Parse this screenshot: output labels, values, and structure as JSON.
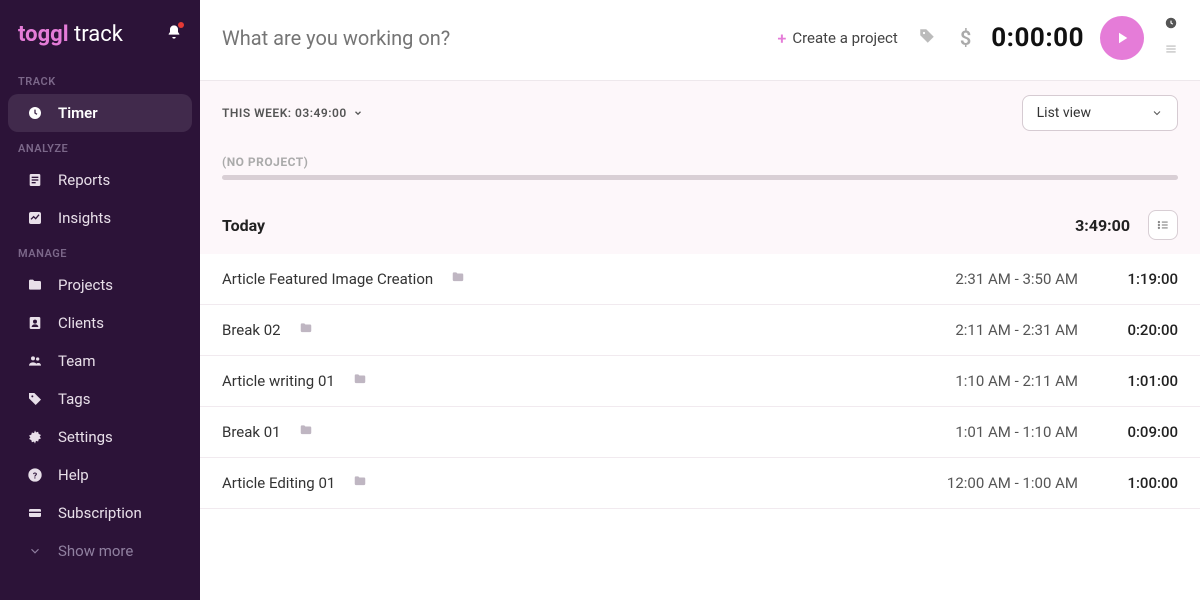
{
  "logo": {
    "part1": "toggl",
    "part2": " track"
  },
  "sidebar": {
    "sections": [
      {
        "label": "TRACK",
        "items": [
          {
            "icon": "clock-icon",
            "label": "Timer",
            "active": true
          }
        ]
      },
      {
        "label": "ANALYZE",
        "items": [
          {
            "icon": "reports-icon",
            "label": "Reports"
          },
          {
            "icon": "insights-icon",
            "label": "Insights"
          }
        ]
      },
      {
        "label": "MANAGE",
        "items": [
          {
            "icon": "folder-icon",
            "label": "Projects"
          },
          {
            "icon": "client-icon",
            "label": "Clients"
          },
          {
            "icon": "team-icon",
            "label": "Team"
          },
          {
            "icon": "tag-icon",
            "label": "Tags"
          },
          {
            "icon": "settings-icon",
            "label": "Settings"
          },
          {
            "icon": "help-icon",
            "label": "Help"
          },
          {
            "icon": "subscription-icon",
            "label": "Subscription"
          }
        ]
      }
    ],
    "show_more": "Show more"
  },
  "timer": {
    "placeholder": "What are you working on?",
    "create_project": "Create a project",
    "display": "0:00:00"
  },
  "toolbar": {
    "week_label": "THIS WEEK: 03:49:00",
    "view_label": "List view"
  },
  "noproject_label": "(NO PROJECT)",
  "day": {
    "title": "Today",
    "total": "3:49:00"
  },
  "entries": [
    {
      "desc": "Article Featured Image Creation",
      "range": "2:31 AM - 3:50 AM",
      "dur": "1:19:00"
    },
    {
      "desc": "Break 02",
      "range": "2:11 AM - 2:31 AM",
      "dur": "0:20:00"
    },
    {
      "desc": "Article writing 01",
      "range": "1:10 AM - 2:11 AM",
      "dur": "1:01:00"
    },
    {
      "desc": "Break 01",
      "range": "1:01 AM - 1:10 AM",
      "dur": "0:09:00"
    },
    {
      "desc": "Article Editing 01",
      "range": "12:00 AM - 1:00 AM",
      "dur": "1:00:00"
    }
  ]
}
